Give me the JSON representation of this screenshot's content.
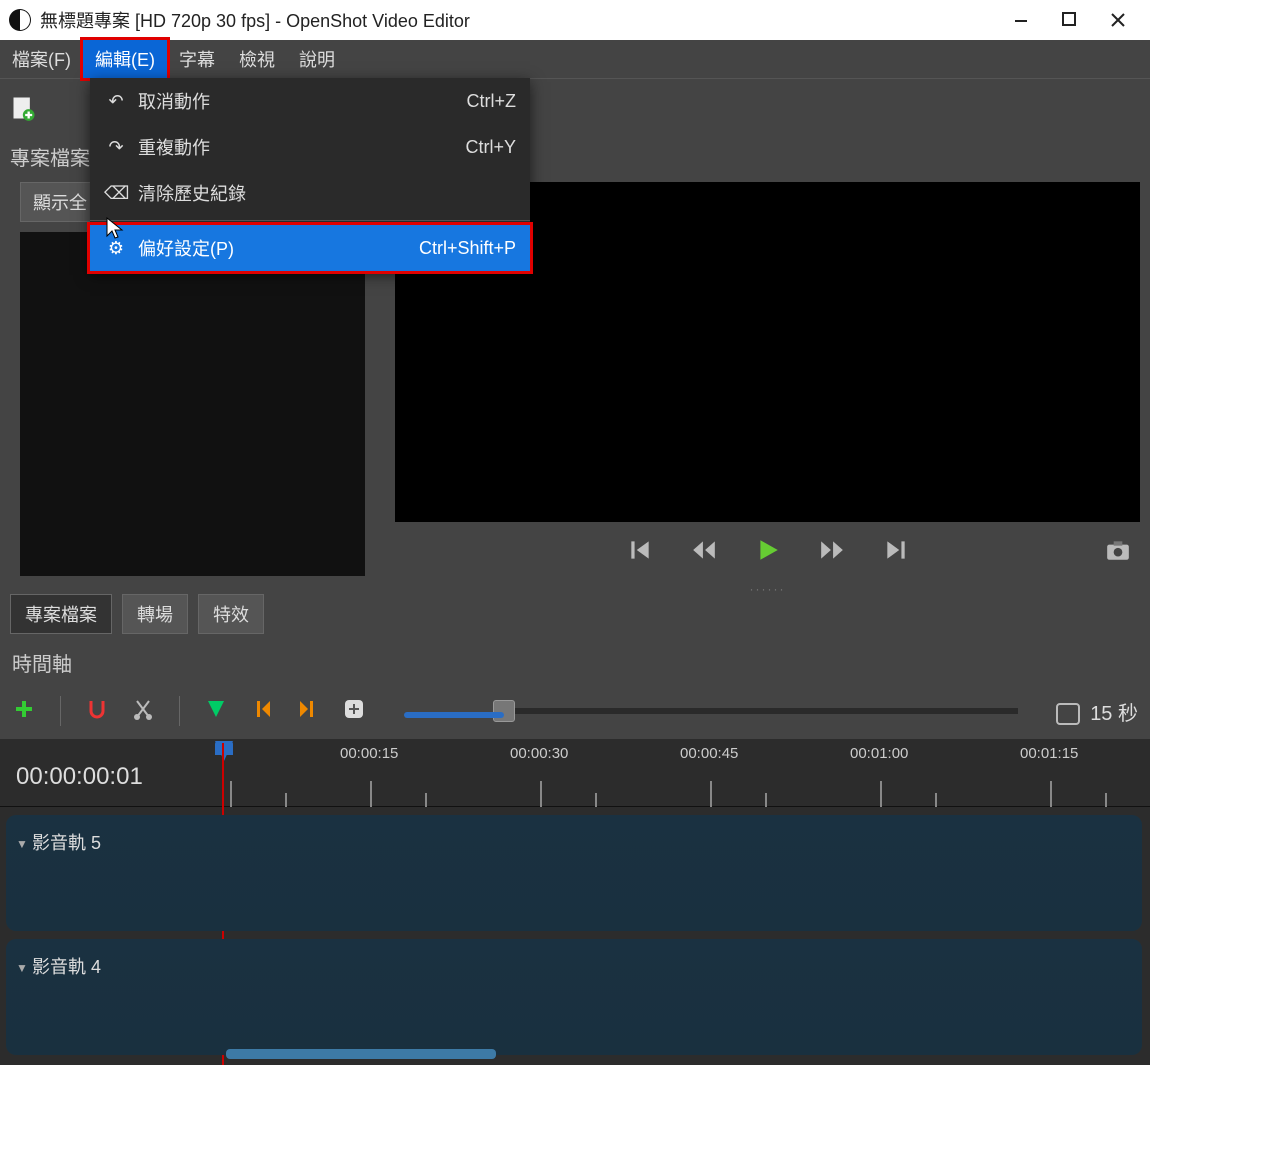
{
  "window_title": "無標題專案 [HD 720p 30 fps] - OpenShot Video Editor",
  "menubar": {
    "file": "檔案(F)",
    "edit": "編輯(E)",
    "subtitles": "字幕",
    "view": "檢視",
    "help": "說明"
  },
  "dropdown": {
    "undo": {
      "label": "取消動作",
      "shortcut": "Ctrl+Z"
    },
    "redo": {
      "label": "重複動作",
      "shortcut": "Ctrl+Y"
    },
    "clear": {
      "label": "清除歷史紀錄",
      "shortcut": ""
    },
    "prefs": {
      "label": "偏好設定(P)",
      "shortcut": "Ctrl+Shift+P"
    }
  },
  "panels": {
    "project_files_title": "專案檔案",
    "show_all": "顯示全",
    "timeline_title": "時間軸"
  },
  "tabs": {
    "project": "專案檔案",
    "transitions": "轉場",
    "effects": "特效"
  },
  "timeline": {
    "duration_label": "15 秒",
    "current_time": "00:00:00:01",
    "ruler": [
      "00:00:15",
      "00:00:30",
      "00:00:45",
      "00:01:00",
      "00:01:15"
    ],
    "tracks": [
      {
        "name": "影音軌 5"
      },
      {
        "name": "影音軌 4"
      }
    ]
  }
}
